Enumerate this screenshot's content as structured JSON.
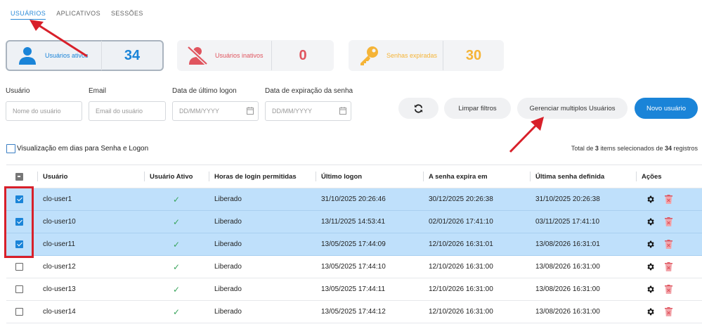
{
  "tabs": [
    {
      "label": "USUÁRIOS",
      "active": true
    },
    {
      "label": "APLICATIVOS",
      "active": false
    },
    {
      "label": "SESSÕES",
      "active": false
    }
  ],
  "cards": [
    {
      "label": "Usuários ativos",
      "value": "34",
      "color": "#1a84d8",
      "icon": "user-icon"
    },
    {
      "label": "Usuários inativos",
      "value": "0",
      "color": "#e0555f",
      "icon": "user-off-icon"
    },
    {
      "label": "Senhas expiradas",
      "value": "30",
      "color": "#f5b437",
      "icon": "key-icon"
    }
  ],
  "filters": {
    "user_label": "Usuário",
    "user_placeholder": "Nome do usuário",
    "email_label": "Email",
    "email_placeholder": "Email do usuário",
    "last_logon_label": "Data de último logon",
    "last_logon_placeholder": "DD/MM/YYYY",
    "expiry_label": "Data de expiração da senha",
    "expiry_placeholder": "DD/MM/YYYY"
  },
  "buttons": {
    "clear": "Limpar filtros",
    "manage": "Gerenciar multiplos Usuários",
    "new_user": "Novo usuário"
  },
  "days_toggle_label": "Visualização em dias para Senha e Logon",
  "total": {
    "prefix": "Total de ",
    "selected": "3",
    "middle": " items selecionados de ",
    "count": "34",
    "suffix": " registros"
  },
  "columns": [
    "Usuário",
    "Usuário Ativo",
    "Horas de login permitidas",
    "Último logon",
    "A senha expira em",
    "Última senha definida",
    "Ações"
  ],
  "rows": [
    {
      "user": "clo-user1",
      "hours": "Liberado",
      "last_logon": "31/10/2025 20:26:46",
      "expires": "30/12/2025 20:26:38",
      "last_set": "31/10/2025 20:26:38",
      "selected": true
    },
    {
      "user": "clo-user10",
      "hours": "Liberado",
      "last_logon": "13/11/2025 14:53:41",
      "expires": "02/01/2026 17:41:10",
      "last_set": "03/11/2025 17:41:10",
      "selected": true
    },
    {
      "user": "clo-user11",
      "hours": "Liberado",
      "last_logon": "13/05/2025 17:44:09",
      "expires": "12/10/2026 16:31:01",
      "last_set": "13/08/2026 16:31:01",
      "selected": true
    },
    {
      "user": "clo-user12",
      "hours": "Liberado",
      "last_logon": "13/05/2025 17:44:10",
      "expires": "12/10/2026 16:31:00",
      "last_set": "13/08/2026 16:31:00",
      "selected": false
    },
    {
      "user": "clo-user13",
      "hours": "Liberado",
      "last_logon": "13/05/2025 17:44:11",
      "expires": "12/10/2026 16:31:00",
      "last_set": "13/08/2026 16:31:00",
      "selected": false
    },
    {
      "user": "clo-user14",
      "hours": "Liberado",
      "last_logon": "13/05/2025 17:44:12",
      "expires": "12/10/2026 16:31:00",
      "last_set": "13/08/2026 16:31:00",
      "selected": false
    }
  ],
  "colors": {
    "accent": "#1a84d8",
    "selected_row": "#bfe0fb",
    "annotation": "#d8202a",
    "check": "#3aa55d",
    "delete": "#e0555f"
  }
}
